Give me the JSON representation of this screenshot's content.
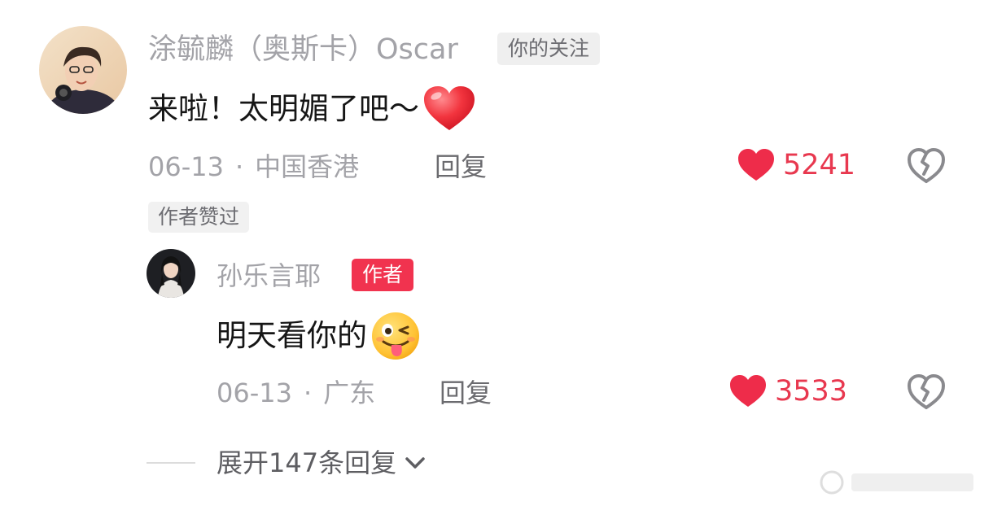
{
  "comment": {
    "username": "涂毓麟（奥斯卡）Oscar",
    "follow_badge": "你的关注",
    "text": "来啦！太明媚了吧～",
    "text_emoji": "red-heart-emoji",
    "date": "06-13",
    "separator": "·",
    "location": "中国香港",
    "reply_label": "回复",
    "likes": "5241",
    "author_liked_tag": "作者赞过"
  },
  "reply": {
    "username": "孙乐言耶",
    "author_badge": "作者",
    "text": "明天看你的",
    "text_emoji": "winking-tongue-emoji",
    "date": "06-13",
    "separator": "·",
    "location": "广东",
    "reply_label": "回复",
    "likes": "3533"
  },
  "expand": {
    "label": "展开147条回复"
  },
  "colors": {
    "like_red": "#e8384f",
    "author_badge_bg": "#f1334f",
    "muted_text": "#a3a3a8"
  }
}
